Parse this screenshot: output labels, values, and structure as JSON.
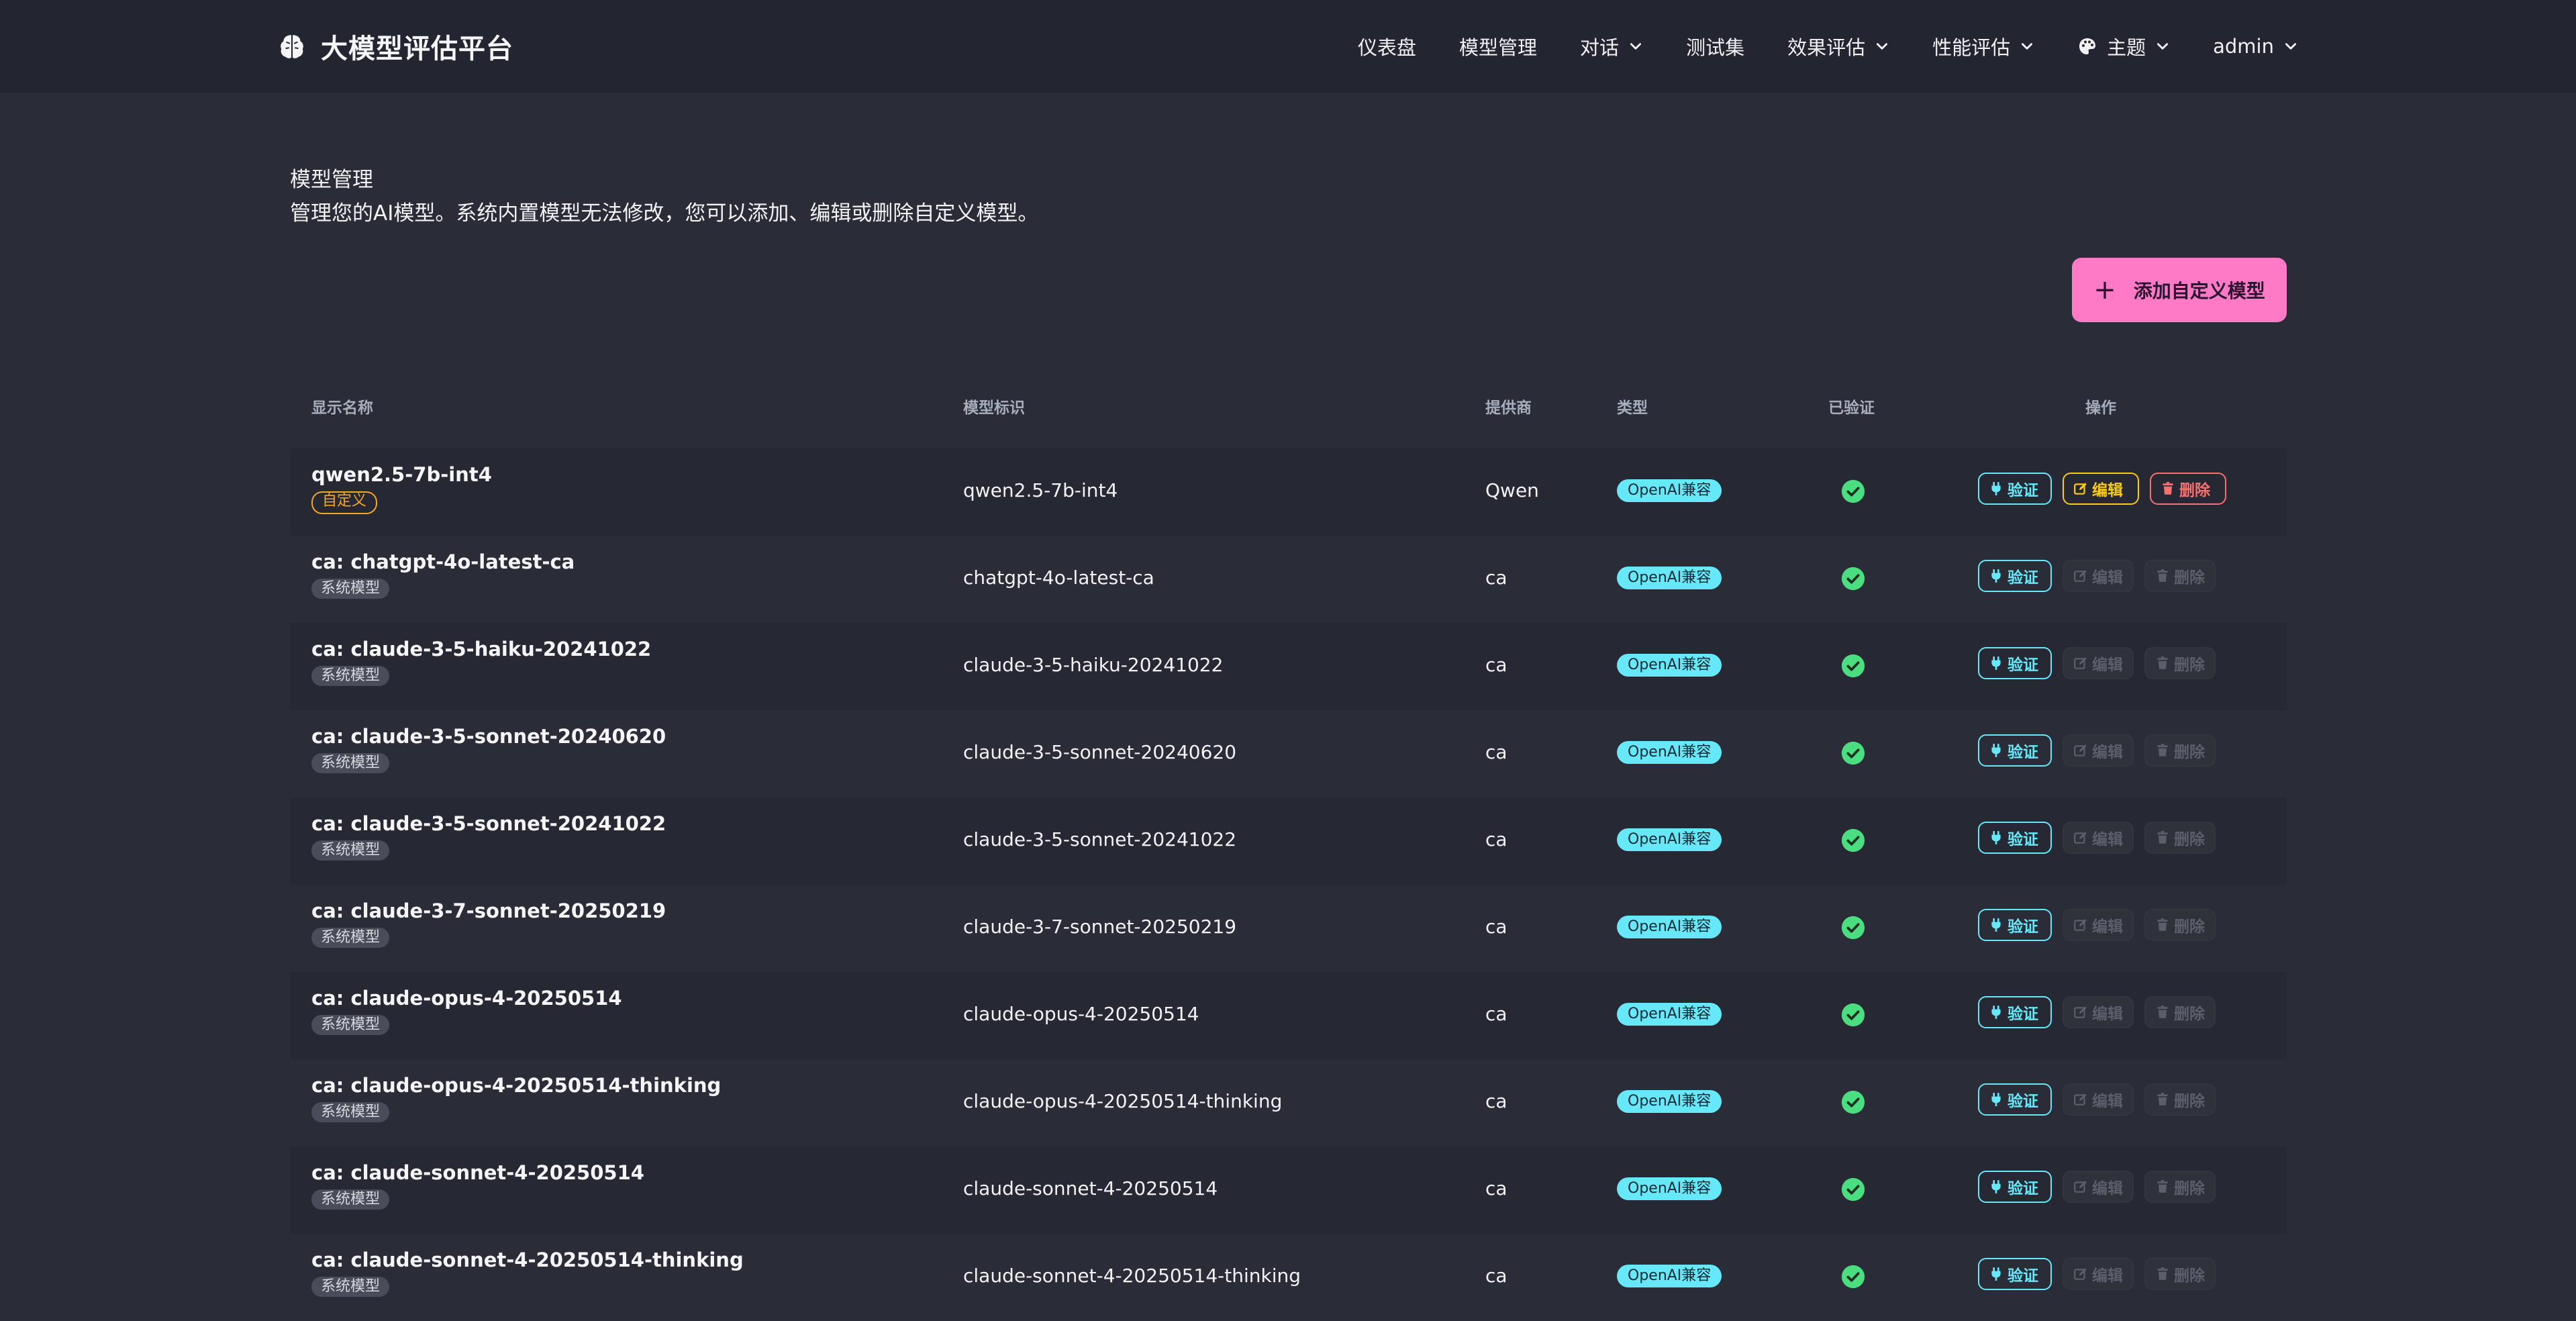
{
  "app": {
    "title": "大模型评估平台",
    "nav": [
      {
        "label": "仪表盘",
        "dropdown": false
      },
      {
        "label": "模型管理",
        "dropdown": false
      },
      {
        "label": "对话",
        "dropdown": true
      },
      {
        "label": "测试集",
        "dropdown": false
      },
      {
        "label": "效果评估",
        "dropdown": true
      },
      {
        "label": "性能评估",
        "dropdown": true
      },
      {
        "label": "主题",
        "dropdown": true,
        "icon": "palette-icon"
      },
      {
        "label": "admin",
        "dropdown": true
      }
    ]
  },
  "page": {
    "title": "模型管理",
    "description": "管理您的AI模型。系统内置模型无法修改，您可以添加、编辑或删除自定义模型。",
    "add_button": {
      "icon": "+",
      "label": "添加自定义模型"
    }
  },
  "table": {
    "headers": {
      "name": "显示名称",
      "id": "模型标识",
      "provider": "提供商",
      "type": "类型",
      "verified": "已验证",
      "actions": "操作"
    },
    "action_labels": {
      "verify": "验证",
      "edit": "编辑",
      "delete": "删除"
    },
    "rows": [
      {
        "name": "qwen2.5-7b-int4",
        "tag": "自定义",
        "tag_kind": "custom",
        "model_id": "qwen2.5-7b-int4",
        "provider": "Qwen",
        "type": "OpenAI兼容",
        "verified": true,
        "editable": true
      },
      {
        "name": "ca: chatgpt-4o-latest-ca",
        "tag": "系统模型",
        "tag_kind": "system",
        "model_id": "chatgpt-4o-latest-ca",
        "provider": "ca",
        "type": "OpenAI兼容",
        "verified": true,
        "editable": false
      },
      {
        "name": "ca: claude-3-5-haiku-20241022",
        "tag": "系统模型",
        "tag_kind": "system",
        "model_id": "claude-3-5-haiku-20241022",
        "provider": "ca",
        "type": "OpenAI兼容",
        "verified": true,
        "editable": false
      },
      {
        "name": "ca: claude-3-5-sonnet-20240620",
        "tag": "系统模型",
        "tag_kind": "system",
        "model_id": "claude-3-5-sonnet-20240620",
        "provider": "ca",
        "type": "OpenAI兼容",
        "verified": true,
        "editable": false
      },
      {
        "name": "ca: claude-3-5-sonnet-20241022",
        "tag": "系统模型",
        "tag_kind": "system",
        "model_id": "claude-3-5-sonnet-20241022",
        "provider": "ca",
        "type": "OpenAI兼容",
        "verified": true,
        "editable": false
      },
      {
        "name": "ca: claude-3-7-sonnet-20250219",
        "tag": "系统模型",
        "tag_kind": "system",
        "model_id": "claude-3-7-sonnet-20250219",
        "provider": "ca",
        "type": "OpenAI兼容",
        "verified": true,
        "editable": false
      },
      {
        "name": "ca: claude-opus-4-20250514",
        "tag": "系统模型",
        "tag_kind": "system",
        "model_id": "claude-opus-4-20250514",
        "provider": "ca",
        "type": "OpenAI兼容",
        "verified": true,
        "editable": false
      },
      {
        "name": "ca: claude-opus-4-20250514-thinking",
        "tag": "系统模型",
        "tag_kind": "system",
        "model_id": "claude-opus-4-20250514-thinking",
        "provider": "ca",
        "type": "OpenAI兼容",
        "verified": true,
        "editable": false
      },
      {
        "name": "ca: claude-sonnet-4-20250514",
        "tag": "系统模型",
        "tag_kind": "system",
        "model_id": "claude-sonnet-4-20250514",
        "provider": "ca",
        "type": "OpenAI兼容",
        "verified": true,
        "editable": false
      },
      {
        "name": "ca: claude-sonnet-4-20250514-thinking",
        "tag": "系统模型",
        "tag_kind": "system",
        "model_id": "claude-sonnet-4-20250514-thinking",
        "provider": "ca",
        "type": "OpenAI兼容",
        "verified": true,
        "editable": false
      }
    ]
  },
  "colors": {
    "background": "#2a2c37",
    "navbar": "#232530",
    "primary": "#ff7ac6",
    "info": "#67e8f9",
    "success": "#4ade80",
    "warning": "#facc15",
    "error": "#f87171",
    "custom_tag": "#f5a623"
  }
}
